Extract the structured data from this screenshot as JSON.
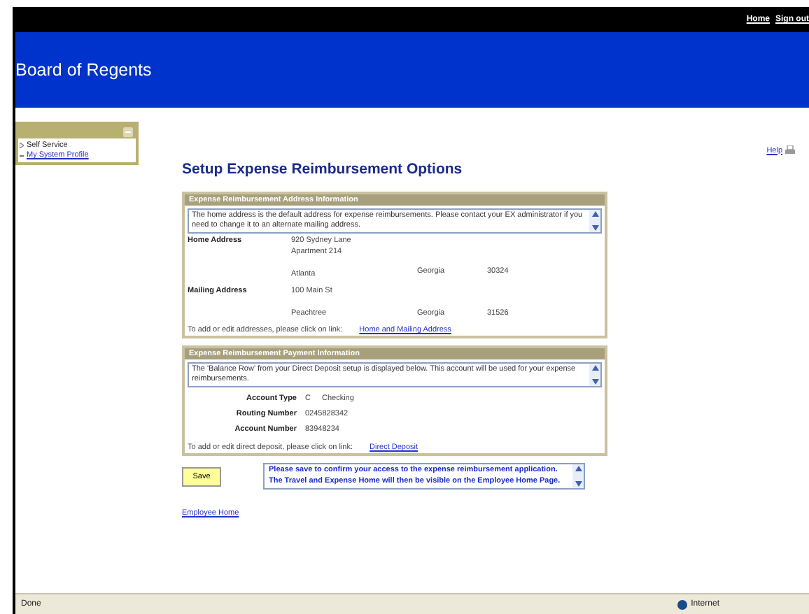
{
  "top_links": [
    "Home",
    "Sign out"
  ],
  "banner": {
    "title": "Board of Regents"
  },
  "sidebar": {
    "expanded": true,
    "items": [
      {
        "label": "Self Service",
        "kind": "folder"
      },
      {
        "label": "My System Profile",
        "kind": "link"
      }
    ]
  },
  "help": {
    "label": "Help"
  },
  "page_title": "Setup Expense Reimbursement Options",
  "address_section": {
    "header": "Expense Reimbursement Address Information",
    "note": "The home address is the default address for expense reimbursements.  Please contact your EX administrator if you need to change it to an alternate mailing address.",
    "addresses": [
      {
        "label": "Home Address",
        "line1": "920 Sydney Lane",
        "line2": "Apartment 214",
        "city": "Atlanta",
        "state": "Georgia",
        "zip": "30324"
      },
      {
        "label": "Mailing Address",
        "line1": "100 Main St",
        "city": "Peachtree",
        "state": "Georgia",
        "zip": "31526"
      }
    ],
    "footer": "To add or edit addresses, please click on link:",
    "link": "Home and Mailing Address"
  },
  "payment_section": {
    "header": "Expense Reimbursement Payment Information",
    "note": "The 'Balance Row' from your Direct Deposit setup is displayed below.  This account will be used for your expense reimbursements.",
    "fields": [
      {
        "label": "Account Type",
        "value": "C",
        "value_2": "Checking"
      },
      {
        "label": "Routing Number",
        "value": "0245828342"
      },
      {
        "label": "Account Number",
        "value": "83948234"
      }
    ],
    "footer": "To add or edit direct deposit, please click on link:",
    "link": "Direct Deposit"
  },
  "save_button": "Save",
  "message": "Please save to confirm your access to the expense reimbursement application.  The Travel and Expense Home will then be visible on the Employee Home Page.",
  "employee_home": "Employee Home",
  "status_bar": {
    "left": "Done",
    "zone": "Internet"
  }
}
